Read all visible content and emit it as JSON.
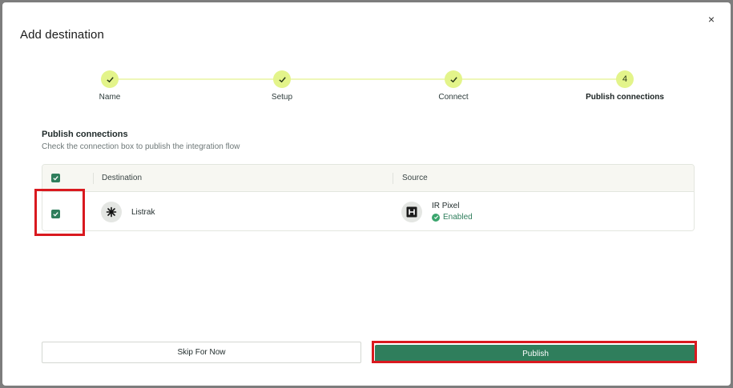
{
  "modal": {
    "title": "Add destination",
    "close_glyph": "×"
  },
  "stepper": {
    "steps": [
      {
        "label": "Name",
        "state": "done",
        "marker": "check-icon"
      },
      {
        "label": "Setup",
        "state": "done",
        "marker": "check-icon"
      },
      {
        "label": "Connect",
        "state": "done",
        "marker": "check-icon"
      },
      {
        "label": "Publish connections",
        "state": "active",
        "number": "4"
      }
    ]
  },
  "section": {
    "title": "Publish connections",
    "subtitle": "Check the connection box to publish the integration flow"
  },
  "table": {
    "columns": [
      "Destination",
      "Source"
    ],
    "header_checked": true,
    "rows": [
      {
        "checked": true,
        "destination": {
          "name": "Listrak",
          "icon": "listrak-logo-icon"
        },
        "source": {
          "name": "IR Pixel",
          "icon": "ir-pixel-logo-icon",
          "status": "Enabled"
        }
      }
    ]
  },
  "buttons": {
    "skip_label": "Skip For Now",
    "publish_label": "Publish"
  },
  "colors": {
    "accent": "#2f7e5c",
    "step_circle": "#e3f48a",
    "highlight": "#d9191f"
  }
}
